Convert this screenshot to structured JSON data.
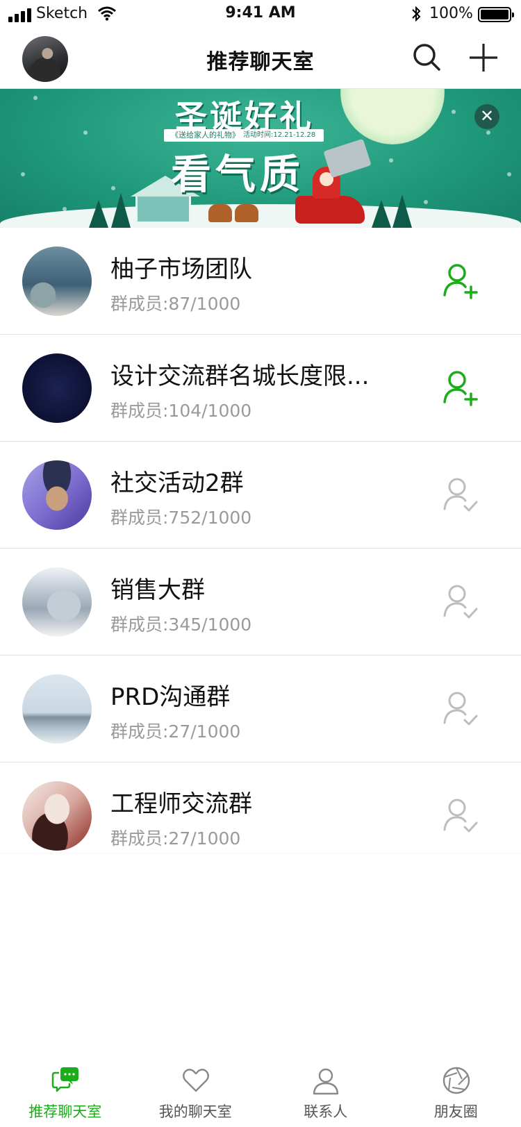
{
  "status_bar": {
    "carrier": "Sketch",
    "time": "9:41 AM",
    "battery": "100%"
  },
  "nav": {
    "title": "推荐聊天室"
  },
  "banner": {
    "headline": "圣诞好礼",
    "subline": "《送给家人的礼物》",
    "dates": "活动时间:12.21-12.28",
    "headline2": "看气质"
  },
  "groups": [
    {
      "name": "柚子市场团队",
      "members": "群成员:87/1000",
      "status": "join"
    },
    {
      "name": "设计交流群名城长度限...",
      "members": "群成员:104/1000",
      "status": "join"
    },
    {
      "name": "社交活动2群",
      "members": "群成员:752/1000",
      "status": "joined"
    },
    {
      "name": "销售大群",
      "members": "群成员:345/1000",
      "status": "joined"
    },
    {
      "name": "PRD沟通群",
      "members": "群成员:27/1000",
      "status": "joined"
    },
    {
      "name": "工程师交流群",
      "members": "群成员:27/1000",
      "status": "joined"
    }
  ],
  "tabs": [
    {
      "label": "推荐聊天室",
      "icon": "chat-bubbles-icon",
      "active": true
    },
    {
      "label": "我的聊天室",
      "icon": "heart-icon",
      "active": false
    },
    {
      "label": "联系人",
      "icon": "person-icon",
      "active": false
    },
    {
      "label": "朋友圈",
      "icon": "aperture-icon",
      "active": false
    }
  ],
  "colors": {
    "accent_green": "#1aad19",
    "join_icon": "#1aad19",
    "joined_icon": "#bdbdbd",
    "banner_green": "#1f9a7a"
  }
}
